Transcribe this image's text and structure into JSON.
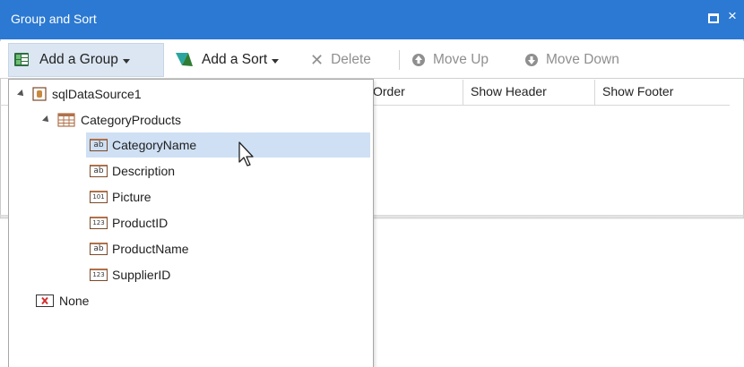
{
  "window": {
    "title": "Group and Sort",
    "maximize_icon": "maximize-icon",
    "close_glyph": "×"
  },
  "toolbar": {
    "add_group": "Add a Group",
    "add_sort": "Add a Sort",
    "delete": "Delete",
    "move_up": "Move Up",
    "move_down": "Move Down"
  },
  "grid": {
    "columns": [
      "Order",
      "Show Header",
      "Show Footer"
    ]
  },
  "tree": {
    "root": {
      "label": "sqlDataSource1",
      "icon": "datasource-icon"
    },
    "table": {
      "label": "CategoryProducts",
      "icon": "table-icon"
    },
    "fields": [
      {
        "label": "CategoryName",
        "type_badge": "ab",
        "selected": true
      },
      {
        "label": "Description",
        "type_badge": "ab",
        "selected": false
      },
      {
        "label": "Picture",
        "type_badge": "101",
        "selected": false
      },
      {
        "label": "ProductID",
        "type_badge": "123",
        "selected": false
      },
      {
        "label": "ProductName",
        "type_badge": "ab",
        "selected": false
      },
      {
        "label": "SupplierID",
        "type_badge": "123",
        "selected": false
      }
    ],
    "none": {
      "label": "None",
      "icon": "none-icon"
    }
  },
  "colors": {
    "titlebar": "#2b79d2",
    "selection": "#cfe0f4",
    "disabled_text": "#8f8f8f"
  }
}
